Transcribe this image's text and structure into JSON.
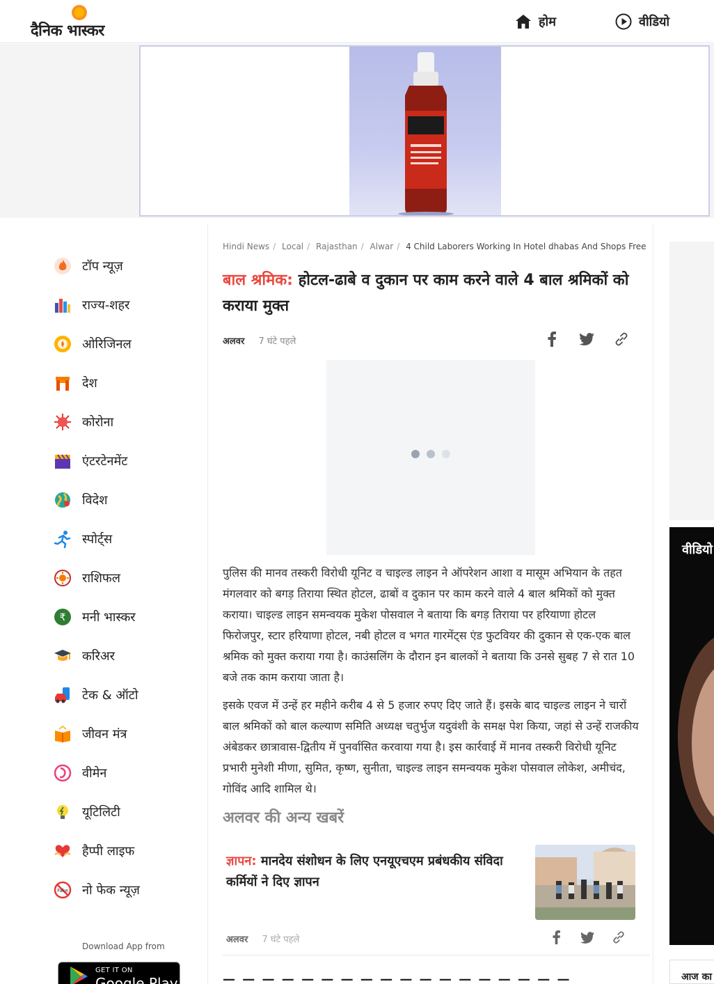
{
  "header": {
    "logo_text": "दैनिक भास्कर",
    "nav": [
      {
        "label": "होम",
        "icon": "home-icon"
      },
      {
        "label": "वीडियो",
        "icon": "play-icon"
      }
    ]
  },
  "sidebar": {
    "items": [
      {
        "label": "टॉप न्यूज़",
        "icon": "flame-icon"
      },
      {
        "label": "राज्य-शहर",
        "icon": "city-icon"
      },
      {
        "label": "ओरिजिनल",
        "icon": "original-icon"
      },
      {
        "label": "देश",
        "icon": "india-gate-icon"
      },
      {
        "label": "कोरोना",
        "icon": "virus-icon"
      },
      {
        "label": "एंटरटेनमेंट",
        "icon": "clapperboard-icon"
      },
      {
        "label": "विदेश",
        "icon": "globe-icon"
      },
      {
        "label": "स्पोर्ट्स",
        "icon": "runner-icon"
      },
      {
        "label": "राशिफल",
        "icon": "zodiac-icon"
      },
      {
        "label": "मनी भास्कर",
        "icon": "rupee-icon"
      },
      {
        "label": "करिअर",
        "icon": "graduation-cap-icon"
      },
      {
        "label": "टेक & ऑटो",
        "icon": "tech-auto-icon"
      },
      {
        "label": "जीवन मंत्र",
        "icon": "book-icon"
      },
      {
        "label": "वीमेन",
        "icon": "women-icon"
      },
      {
        "label": "यूटिलिटी",
        "icon": "bulb-icon"
      },
      {
        "label": "हैप्पी लाइफ",
        "icon": "heart-hands-icon"
      },
      {
        "label": "नो फेक न्यूज़",
        "icon": "no-fake-icon"
      }
    ],
    "download_label": "Download App from",
    "google_play": {
      "small": "GET IT ON",
      "big": "Google Play"
    }
  },
  "article": {
    "breadcrumb": [
      "Hindi News",
      "Local",
      "Rajasthan",
      "Alwar",
      "4 Child Laborers Working In Hotel dhabas And Shops Free"
    ],
    "kicker": "बाल श्रमिक:",
    "title": " होटल-ढाबे व दुकान पर काम करने वाले 4 बाल श्रमिकों को कराया मुक्त",
    "location": "अलवर",
    "time": "7 घंटे पहले",
    "share_icons": [
      "facebook-icon",
      "twitter-icon",
      "link-icon"
    ],
    "paragraphs": [
      "पुलिस की मानव तस्करी विरोधी यूनिट व चाइल्ड लाइन ने ऑपरेशन आशा व मासूम अभियान के तहत मंगलवार को बगड़ तिराया स्थित होटल, ढाबों व दुकान पर काम करने वाले 4 बाल श्रमिकों को मुक्त कराया। चाइल्ड लाइन समन्वयक मुकेश पोसवाल ने बताया कि बगड़ तिराया पर हरियाणा होटल फिरोजपुर, स्टार हरियाणा होटल, नबी होटल व भगत गारमेंट्स एंड फुटवियर की दुकान से एक-एक बाल श्रमिक को मुक्त कराया गया है। काउंसलिंग के दौरान इन बालकों ने बताया कि उनसे सुबह 7 से रात 10 बजे तक काम कराया जाता है।",
      "इसके एवज में उन्हें हर महीने करीब 4 से 5 हजार रुपए दिए जाते हैं। इसके बाद चाइल्ड लाइन ने चारों बाल श्रमिकों को बाल कल्याण समिति अध्यक्ष चतुर्भुज यदुवंशी के समक्ष पेश किया, जहां से उन्हें राजकीय अंबेडकर छात्रावास-द्वितीय में पुनर्वासित करवाया गया है। इस कार्रवाई में मानव तस्करी विरोधी यूनिट प्रभारी मुनेशी मीणा, सुमित, कृष्ण, सुनीता, चाइल्ड लाइन समन्वयक मुकेश पोसवाल लोकेश, अमीचंद, गोविंद आदि शामिल थे।"
    ],
    "video_loading_dots": [
      "#9aa4b1",
      "#b9c1cc",
      "#dde2e8"
    ]
  },
  "more_news": {
    "heading": "अलवर की अन्य खबरें",
    "items": [
      {
        "kicker": "ज्ञापन:",
        "title": " मानदेय संशोधन के लिए एनयूएचएम प्रबंधकीय संविदा कर्मियों ने दिए ज्ञापन",
        "location": "अलवर",
        "time": "7 घंटे पहले"
      }
    ],
    "next_teaser": "— — — — — — — — — — — — — — — — — —"
  },
  "right_rail": {
    "video_label": "वीडियो",
    "bottom_label": "आज का"
  },
  "colors": {
    "accent": "#e9483f",
    "text": "#212121",
    "muted": "#8a8a8a"
  }
}
